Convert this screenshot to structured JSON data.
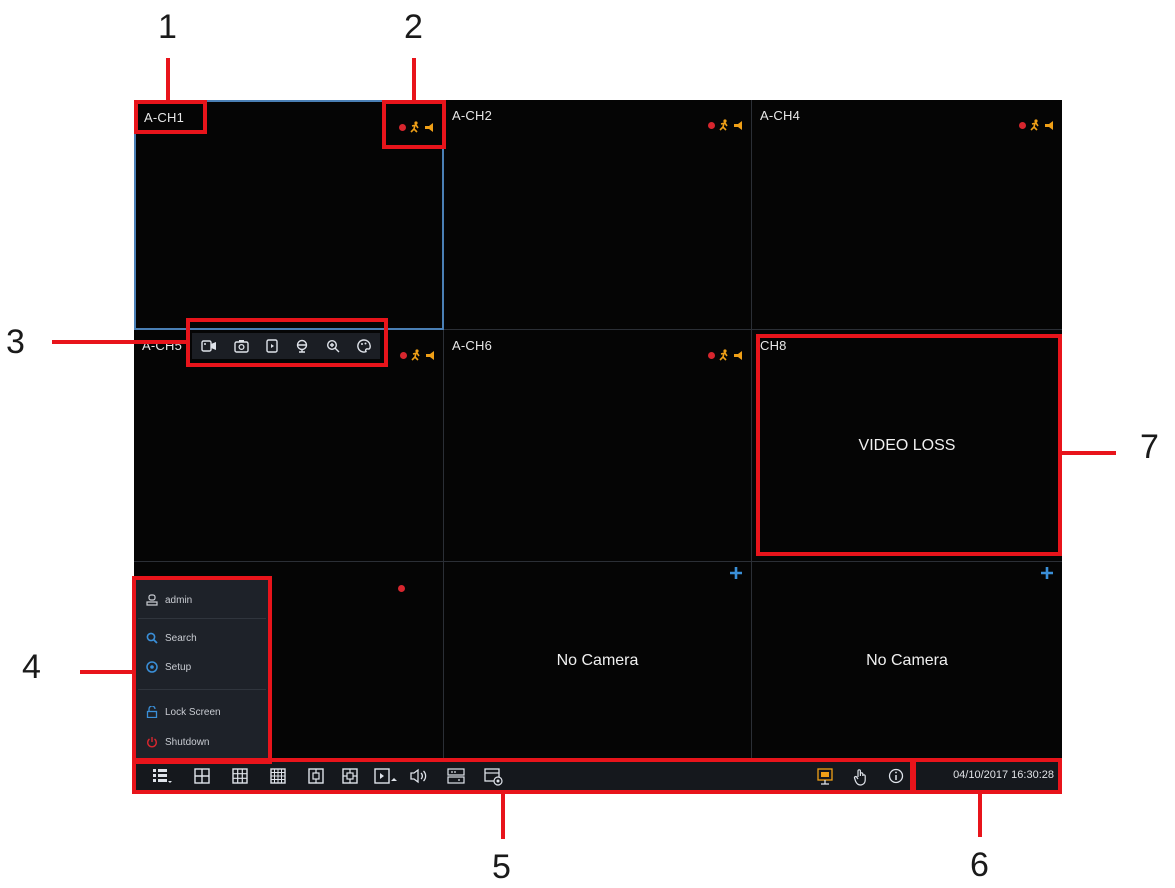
{
  "callouts": [
    "1",
    "2",
    "3",
    "4",
    "5",
    "6",
    "7"
  ],
  "channels": [
    {
      "label": "A-CH1"
    },
    {
      "label": "A-CH2"
    },
    {
      "label": "A-CH4"
    },
    {
      "label": "A-CH5"
    },
    {
      "label": "A-CH6"
    },
    {
      "label": "CH8",
      "message": "VIDEO LOSS"
    },
    {
      "label": ""
    },
    {
      "label": "",
      "message": "No Camera"
    },
    {
      "label": "",
      "message": "No Camera"
    }
  ],
  "quick_toolbar": [
    "record-icon",
    "snapshot-icon",
    "playback-icon",
    "ptz-icon",
    "zoom-icon",
    "color-icon"
  ],
  "start_menu": {
    "user": "admin",
    "search": "Search",
    "setup": "Setup",
    "lock": "Lock Screen",
    "shutdown": "Shutdown"
  },
  "taskbar": {
    "left_icons": [
      "start-menu-icon",
      "layout-4-icon",
      "layout-9-icon",
      "layout-16-icon",
      "layout-pip-icon",
      "layout-pip2-icon",
      "sequence-icon",
      "volume-icon",
      "playback-quality-icon",
      "record-status-icon"
    ],
    "right_icons": [
      "screen-icon",
      "hand-icon",
      "info-icon"
    ],
    "datetime": "04/10/2017 16:30:28"
  },
  "colors": {
    "callout_red": "#e8141b",
    "selection_blue": "#4a7fb5",
    "rec_red": "#d7262e",
    "motion_orange": "#f0a017",
    "plus_blue": "#3a8fd8"
  }
}
